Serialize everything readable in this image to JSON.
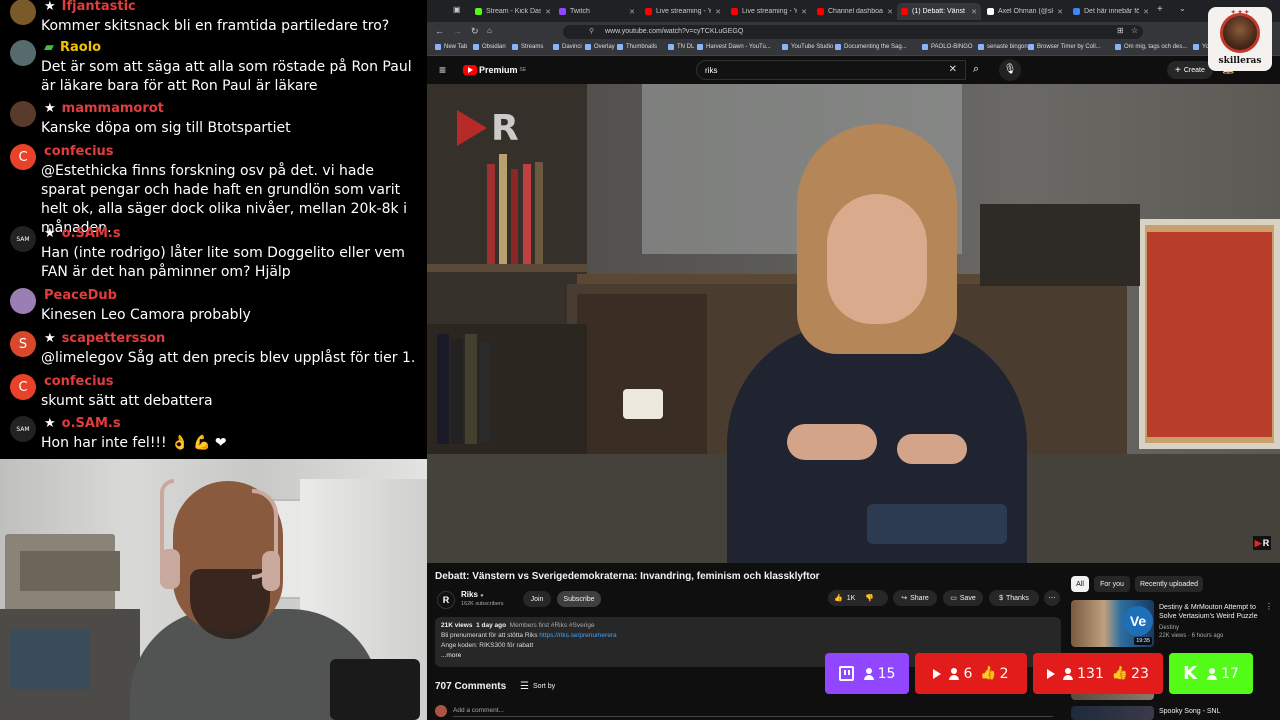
{
  "chat": {
    "messages": [
      {
        "user": "Ifjantastic",
        "user_color": "#e33c3c",
        "text": "Kommer skitsnack bli en framtida partiledare tro?",
        "badge": "★",
        "avatar_color": "#7b5a2a",
        "avatar_letter": ""
      },
      {
        "user": "Raolo",
        "user_color": "#f2c200",
        "text": "Det är som att säga att alla som röstade på Ron Paul är läkare bara för att Ron Paul är läkare",
        "badge": "▰",
        "avatar_color": "#556b6e",
        "avatar_letter": ""
      },
      {
        "user": "mammamorot",
        "user_color": "#e33c3c",
        "text": "Kanske döpa om sig till Btotspartiet",
        "badge": "★",
        "avatar_color": "#5a3a2a",
        "avatar_letter": ""
      },
      {
        "user": "confecius",
        "user_color": "#e33c3c",
        "text": "@Estethicka finns forskning osv på det. vi hade sparat pengar och hade haft en grundlön som varit helt ok, alla säger dock olika nivåer, mellan 20k-8k i månaden.",
        "badge": "",
        "avatar_color": "#e8432a",
        "avatar_letter": "C"
      },
      {
        "user": "o.SAM.s",
        "user_color": "#e33c3c",
        "text": "Han (inte rodrigo) låter lite som Doggelito eller vem FAN är det han påminner om? Hjälp",
        "badge": "★",
        "avatar_color": "#222222",
        "avatar_letter": "SAM"
      },
      {
        "user": "PeaceDub",
        "user_color": "#e33c3c",
        "text": "Kinesen Leo Camora probably",
        "badge": "",
        "avatar_color": "#9a7fb5",
        "avatar_letter": ""
      },
      {
        "user": "scapettersson",
        "user_color": "#e33c3c",
        "text": "@limelegov Såg att den precis blev upplåst för tier 1.",
        "badge": "★",
        "avatar_color": "#d9482b",
        "avatar_letter": "S"
      },
      {
        "user": "confecius",
        "user_color": "#e33c3c",
        "text": "skumt sätt att debattera",
        "badge": "",
        "avatar_color": "#e8432a",
        "avatar_letter": "C"
      },
      {
        "user": "o.SAM.s",
        "user_color": "#e33c3c",
        "text": "Hon har inte fel!!! 👌 💪 ❤",
        "badge": "★",
        "avatar_color": "#222222",
        "avatar_letter": "SAM"
      }
    ]
  },
  "browser": {
    "tabs": [
      {
        "label": "Stream - Kick Dashb",
        "color": "#53fc18"
      },
      {
        "label": "Twitch",
        "color": "#9146ff"
      },
      {
        "label": "Live streaming - YouT",
        "color": "#ff0000"
      },
      {
        "label": "Live streaming - YouT",
        "color": "#ff0000"
      },
      {
        "label": "Channel dashboard -",
        "color": "#ff0000"
      },
      {
        "label": "(1) Debatt: Vänst",
        "color": "#ff0000"
      },
      {
        "label": "Axel Öhman (@skille",
        "color": "#ffffff"
      },
      {
        "label": "Det här innebär förä",
        "color": "#4285f4"
      }
    ],
    "url": "www.youtube.com/watch?v=cyTCKLuGEGQ",
    "bookmarks": [
      "New Tab",
      "Obsidian",
      "Streams",
      "Davinci",
      "Overlay",
      "Thumbnails",
      "TN DL",
      "Harvest Dawn - YouTu...",
      "YouTube Studio",
      "Documenting the Sag...",
      "PAOLO-BINGO",
      "senaste bingon",
      "Browser Timer by Coll...",
      "Om mig, tags och des...",
      "You"
    ]
  },
  "youtube": {
    "logo_text": "Premium",
    "logo_sup": "SE",
    "search_value": "riks",
    "create_label": "Create",
    "video": {
      "title": "Debatt: Vänstern vs Sverigedemokraterna: Invandring, feminism och klassklyftor",
      "watermark": "R",
      "corner_badge": "R"
    },
    "channel": {
      "name": "Riks",
      "subscribers": "162K subscribers",
      "join_label": "Join",
      "subscribe_label": "Subscribe"
    },
    "actions": {
      "likes": "1K",
      "share": "Share",
      "save": "Save",
      "thanks": "Thanks"
    },
    "description": {
      "meta_views": "21K views",
      "meta_date": "1 day ago",
      "meta_tags": "Members first  #Riks #Sverige",
      "line1": "Bli prenumerant för att stötta Riks",
      "link1": "https://riks.se/prenumerera",
      "line2": "Ange koden: RIKS300 för rabatt",
      "more": "...more"
    },
    "comments": {
      "count": "707 Comments",
      "sort": "Sort by",
      "add_placeholder": "Add a comment..."
    },
    "chips": [
      "All",
      "For you",
      "Recently uploaded"
    ],
    "recommendations": [
      {
        "title": "Destiny & MrMouton Attempt to Solve Vertasium's Weird Puzzle",
        "channel": "Destiny",
        "meta": "22K views · 6 hours ago",
        "duration": "19:35"
      },
      {
        "title": "Spooky Song - SNL",
        "channel": "",
        "meta": "",
        "duration": ""
      }
    ]
  },
  "widgets": [
    {
      "platform": "twitch",
      "viewers": "15",
      "likes": "",
      "color": "#9146ff"
    },
    {
      "platform": "youtube",
      "viewers": "6",
      "likes": "2",
      "color": "#e21b1b"
    },
    {
      "platform": "youtube",
      "viewers": "131",
      "likes": "23",
      "color": "#e21b1b"
    },
    {
      "platform": "kick",
      "viewers": "17",
      "likes": "",
      "color": "#53fc18"
    }
  ],
  "channel_logo": {
    "label": "skilleras"
  }
}
